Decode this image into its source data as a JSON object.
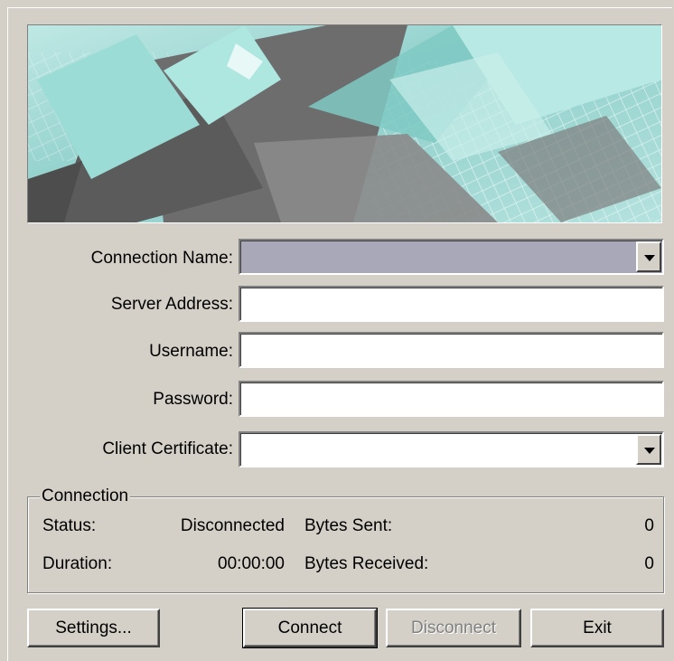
{
  "form": {
    "connection_name_label": "Connection Name:",
    "connection_name_value": "",
    "server_address_label": "Server Address:",
    "server_address_value": "",
    "username_label": "Username:",
    "username_value": "",
    "password_label": "Password:",
    "password_value": "",
    "client_certificate_label": "Client Certificate:",
    "client_certificate_value": ""
  },
  "connection": {
    "group_title": "Connection",
    "status_label": "Status:",
    "status_value": "Disconnected",
    "duration_label": "Duration:",
    "duration_value": "00:00:00",
    "bytes_sent_label": "Bytes Sent:",
    "bytes_sent_value": "0",
    "bytes_received_label": "Bytes Received:",
    "bytes_received_value": "0"
  },
  "buttons": {
    "settings": "Settings...",
    "connect": "Connect",
    "disconnect": "Disconnect",
    "exit": "Exit"
  },
  "colors": {
    "dialog_bg": "#d4d0c8",
    "banner_teal": "#9fd8d4",
    "banner_dark": "#5a5a5a",
    "disabled_combo": "#a8a8b8"
  }
}
